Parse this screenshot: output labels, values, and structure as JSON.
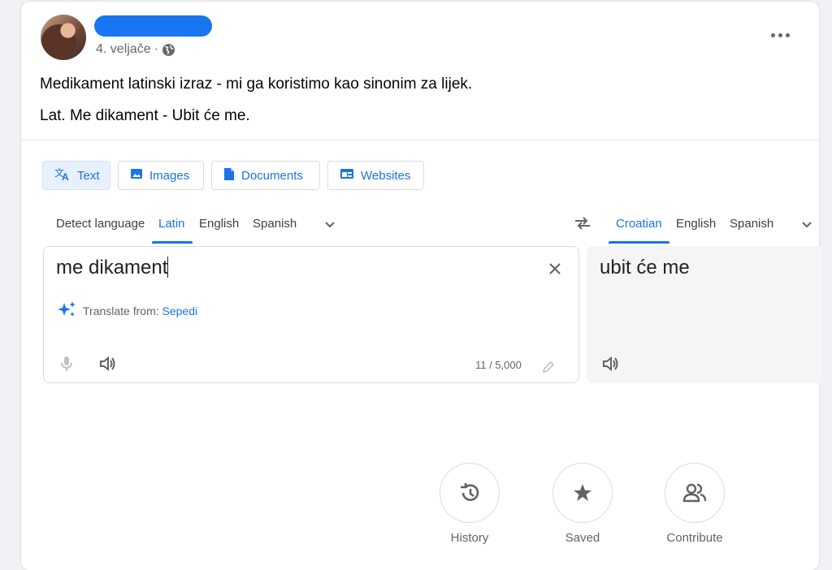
{
  "post": {
    "date": "4. veljače",
    "separator": "·",
    "line1": "Medikament latinski izraz - mi ga koristimo kao sinonim za lijek.",
    "line2": "Lat. Me dikament - Ubit će me."
  },
  "translate": {
    "modes": [
      {
        "label": "Text",
        "icon": "translate-icon"
      },
      {
        "label": "Images",
        "icon": "image-icon"
      },
      {
        "label": "Documents",
        "icon": "document-icon"
      },
      {
        "label": "Websites",
        "icon": "website-icon"
      }
    ],
    "source_langs": [
      "Detect language",
      "Latin",
      "English",
      "Spanish"
    ],
    "target_langs": [
      "Croatian",
      "English",
      "Spanish"
    ],
    "source_text": "me dikament",
    "target_text": "ubit će me",
    "suggestion_prefix": "Translate from: ",
    "suggestion_lang": "Sepedi",
    "char_count": "11 / 5,000",
    "actions": [
      {
        "label": "History",
        "icon": "history-icon"
      },
      {
        "label": "Saved",
        "icon": "star-icon"
      },
      {
        "label": "Contribute",
        "icon": "contribute-icon"
      }
    ]
  },
  "colors": {
    "accent": "#1a73e8",
    "redaction": "#1876f2"
  }
}
